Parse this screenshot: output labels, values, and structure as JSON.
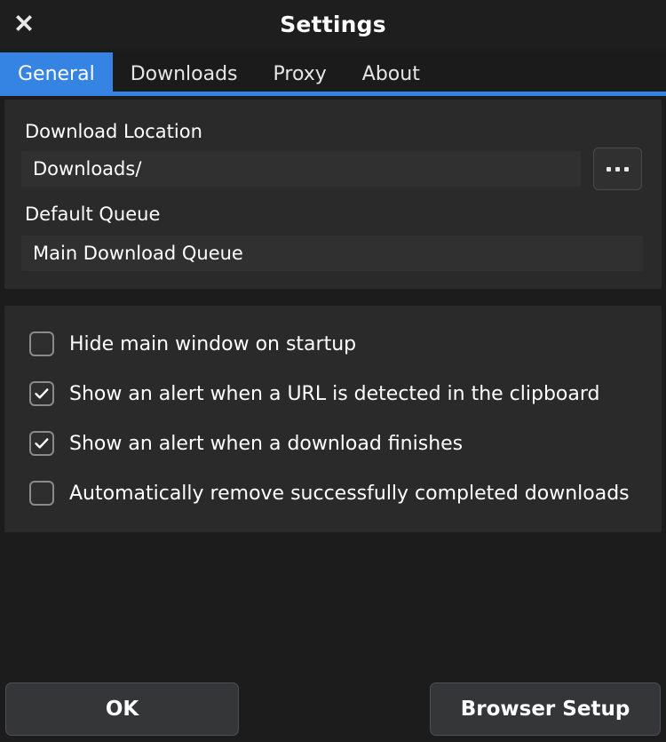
{
  "window": {
    "title": "Settings",
    "close_icon": "close-x-icon"
  },
  "tabs": [
    {
      "label": "General",
      "active": true
    },
    {
      "label": "Downloads",
      "active": false
    },
    {
      "label": "Proxy",
      "active": false
    },
    {
      "label": "About",
      "active": false
    }
  ],
  "general": {
    "download_location_label": "Download Location",
    "download_location_value": "Downloads/",
    "browse_button_icon": "ellipsis-icon",
    "default_queue_label": "Default Queue",
    "default_queue_value": "Main Download Queue"
  },
  "options": [
    {
      "label": "Hide main window on startup",
      "checked": false
    },
    {
      "label": "Show an alert when a URL is detected in the clipboard",
      "checked": true
    },
    {
      "label": "Show an alert when a download finishes",
      "checked": true
    },
    {
      "label": "Automatically remove successfully completed downloads",
      "checked": false
    }
  ],
  "footer": {
    "ok_label": "OK",
    "browser_setup_label": "Browser Setup"
  },
  "colors": {
    "accent": "#3584e4",
    "window_bg": "#1c1c1c",
    "panel_bg": "#2a2a2a",
    "field_bg": "#303030",
    "button_bg": "#343638",
    "text": "#ffffff"
  }
}
